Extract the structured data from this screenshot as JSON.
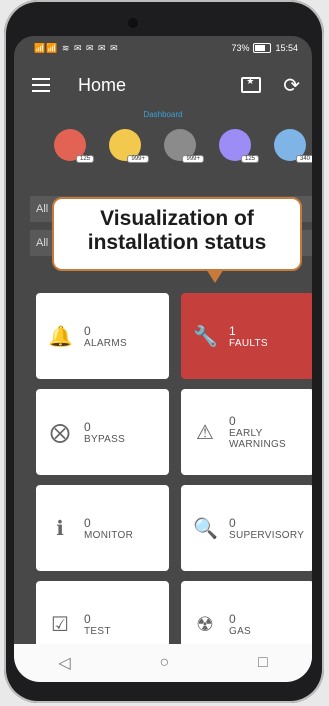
{
  "status": {
    "left_text": "📶📶 ≋ ✉ ✉ ✉ ✉",
    "battery_text": "73%",
    "time": "15:54"
  },
  "appbar": {
    "title": "Home",
    "folder_icon": "star-folder-icon",
    "refresh_icon": "refresh-icon"
  },
  "tabs": {
    "dashboard": "Dashboard"
  },
  "badges": [
    {
      "icon": "bell-icon",
      "count": "125",
      "color": "#e26253"
    },
    {
      "icon": "wrench-icon",
      "count": "999+",
      "color": "#f2c94c"
    },
    {
      "icon": "list-icon",
      "count": "999+",
      "color": "#8b8b8b"
    },
    {
      "icon": "megaphone-icon",
      "count": "125",
      "color": "#9b8cf6"
    },
    {
      "icon": "cloud-icon",
      "count": "340",
      "color": "#7fb4e6"
    }
  ],
  "filters": {
    "filter1_text": "All",
    "filter2_text": "All"
  },
  "cards": [
    {
      "num": "0",
      "label": "ALARMS"
    },
    {
      "num": "1",
      "label": "FAULTS"
    },
    {
      "num": "0",
      "label": "BYPASS"
    },
    {
      "num": "0",
      "label": "EARLY\nWARNINGS"
    },
    {
      "num": "0",
      "label": "MONITOR"
    },
    {
      "num": "0",
      "label": "SUPERVISORY"
    },
    {
      "num": "0",
      "label": "TEST"
    },
    {
      "num": "0",
      "label": "GAS"
    }
  ],
  "callout": {
    "line1": "Visualization of",
    "line2": "installation status"
  },
  "navbar": {
    "back_icon": "back-triangle-icon",
    "home_icon": "home-circle-icon",
    "recent_icon": "recent-square-icon"
  }
}
